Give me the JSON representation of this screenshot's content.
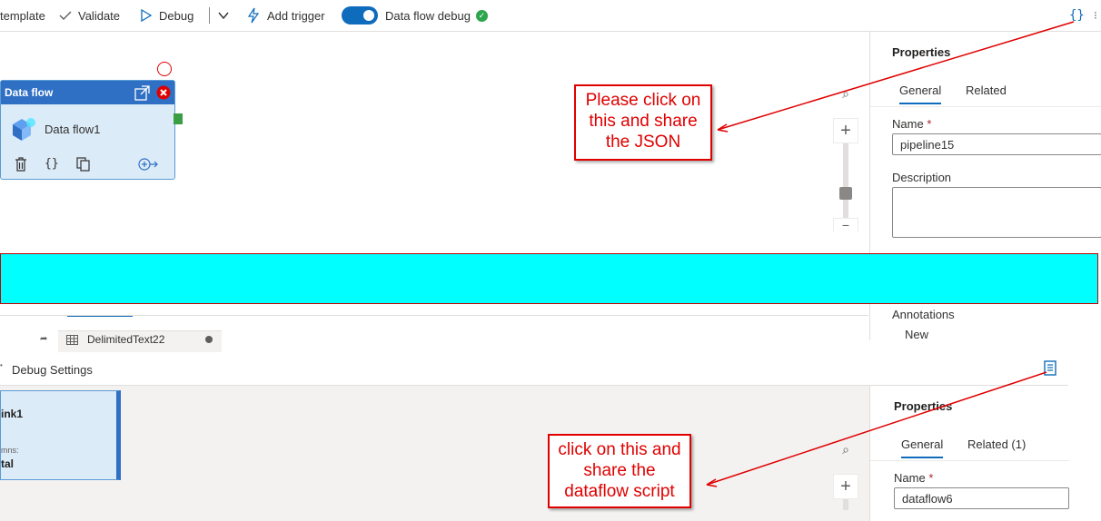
{
  "toolbar": {
    "template_label": "template",
    "validate_label": "Validate",
    "debug_label": "Debug",
    "add_trigger_label": "Add trigger",
    "data_flow_debug_label": "Data flow debug",
    "data_flow_debug_enabled": true,
    "code_icon": "braces-icon"
  },
  "activity": {
    "header": "Data flow",
    "name": "Data flow1",
    "icons": [
      "open-external-icon",
      "delete-red-icon",
      "trash-icon",
      "braces-icon",
      "copy-icon",
      "add-output-icon"
    ]
  },
  "properties_top": {
    "title": "Properties",
    "tabs": [
      "General",
      "Related"
    ],
    "name_label": "Name",
    "name_value": "pipeline15",
    "description_label": "Description",
    "annotations_label": "Annotations",
    "new_label": "New"
  },
  "dataset_tab": {
    "label": "DelimitedText22"
  },
  "debug_settings": {
    "label": "Debug Settings",
    "script_icon": "script-icon"
  },
  "sink": {
    "title": "ink1",
    "columns_label": "mns:",
    "total_label": "tal"
  },
  "properties_bottom": {
    "title": "Properties",
    "tabs": [
      "General",
      "Related (1)"
    ],
    "name_label": "Name",
    "name_value": "dataflow6"
  },
  "callouts": {
    "top": "Please click on this and share the JSON",
    "bottom": "click on this and share the dataflow script"
  },
  "colors": {
    "accent": "#0f6cbd",
    "annotation_red": "#e00000",
    "highlight": "#00ffff",
    "success": "#2da44e"
  }
}
